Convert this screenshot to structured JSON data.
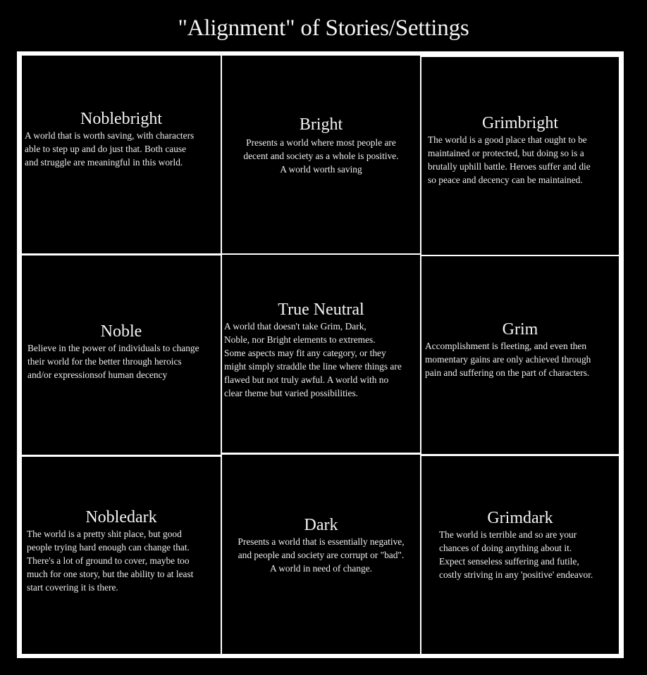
{
  "title": "\"Alignment\" of Stories/Settings",
  "cells": [
    {
      "name": "Noblebright",
      "text": "A world that is worth saving, with characters\nable to step up and do just that.  Both cause\nand struggle are meaningful in this world."
    },
    {
      "name": "Bright",
      "text": "Presents a world where most people are\ndecent and society as a whole is positive.\nA world worth saving"
    },
    {
      "name": "Grimbright",
      "text": "The world is a good place that ought to be\nmaintained or protected, but doing so is a\nbrutally uphill battle.  Heroes suffer and die\nso peace and decency can be maintained."
    },
    {
      "name": "Noble",
      "text": "Believe in the power of individuals to change\ntheir world for the better through heroics\nand/or expressionsof human decency"
    },
    {
      "name": "True Neutral",
      "text": "A world that doesn't take Grim, Dark,\nNoble, nor Bright elements to extremes.\nSome aspects may fit any category, or they\nmight simply straddle the line where things are\nflawed but not truly awful.  A world with no\nclear theme but varied possibilities."
    },
    {
      "name": "Grim",
      "text": "Accomplishment is fleeting, and even then\nmomentary gains are only achieved through\npain and suffering on the part of characters."
    },
    {
      "name": "Nobledark",
      "text": "The world is a pretty shit place, but good\npeople trying hard enough can change that.\nThere's a lot of ground to cover, maybe too\nmuch for one story, but the ability to at least\nstart covering it is there."
    },
    {
      "name": "Dark",
      "text": "Presents a world that is essentially negative,\nand people and society are corrupt or \"bad\".\nA world in need of change."
    },
    {
      "name": "Grimdark",
      "text": "The world is terrible and so are your\nchances of doing anything about it.\nExpect senseless suffering and futile,\ncostly striving in any 'positive' endeavor."
    }
  ]
}
